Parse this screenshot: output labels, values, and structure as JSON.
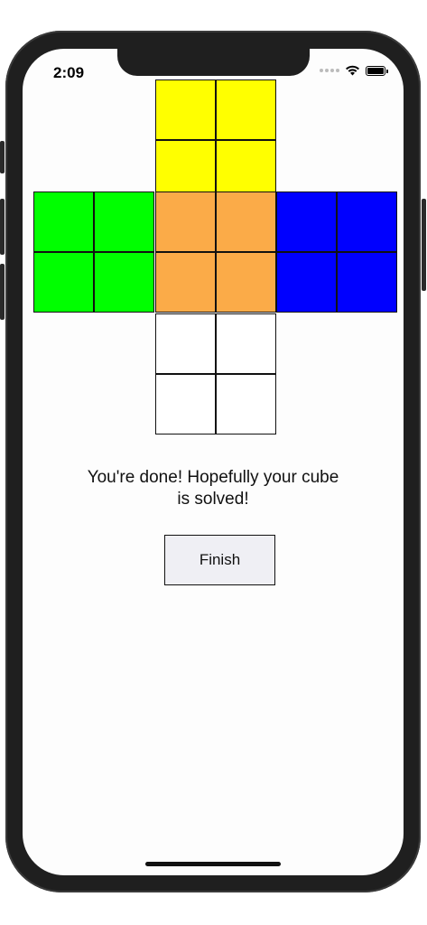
{
  "status_bar": {
    "time": "2:09"
  },
  "cube_faces": {
    "top": {
      "color": "#ffff00"
    },
    "left": {
      "color": "#00ff00"
    },
    "front": {
      "color": "#fbab48"
    },
    "right": {
      "color": "#0000ff"
    },
    "bottom": {
      "color": "#ffffff"
    }
  },
  "message": {
    "line1": "You're done! Hopefully your cube",
    "line2": "is solved!"
  },
  "finish_button": {
    "label": "Finish"
  }
}
